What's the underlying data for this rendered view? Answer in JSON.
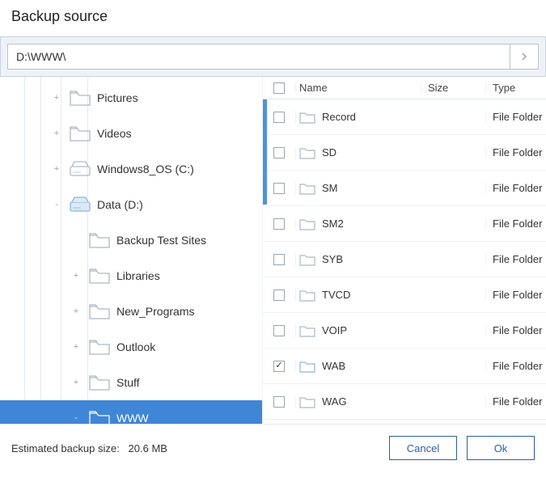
{
  "dialog_title": "Backup source",
  "path_value": "D:\\WWW\\",
  "tree": {
    "items": [
      {
        "indent": 3,
        "expander": "+",
        "icon": "folder",
        "label": "Pictures"
      },
      {
        "indent": 3,
        "expander": "+",
        "icon": "folder",
        "label": "Videos"
      },
      {
        "indent": 3,
        "expander": "+",
        "icon": "drive",
        "label": "Windows8_OS (C:)"
      },
      {
        "indent": 3,
        "expander": "-",
        "icon": "drive-blue",
        "label": "Data (D:)"
      },
      {
        "indent": 4,
        "expander": "",
        "icon": "folder",
        "label": "Backup Test Sites"
      },
      {
        "indent": 4,
        "expander": "+",
        "icon": "folder",
        "label": "Libraries"
      },
      {
        "indent": 4,
        "expander": "+",
        "icon": "folder",
        "label": "New_Programs"
      },
      {
        "indent": 4,
        "expander": "+",
        "icon": "folder",
        "label": "Outlook"
      },
      {
        "indent": 4,
        "expander": "+",
        "icon": "folder",
        "label": "Stuff"
      },
      {
        "indent": 4,
        "expander": "-",
        "icon": "folder-sel",
        "label": "WWW",
        "selected": true
      }
    ]
  },
  "list": {
    "headers": {
      "name": "Name",
      "size": "Size",
      "type": "Type"
    },
    "rows": [
      {
        "checked": false,
        "name": "Record",
        "size": "",
        "type": "File Folder"
      },
      {
        "checked": false,
        "name": "SD",
        "size": "",
        "type": "File Folder"
      },
      {
        "checked": false,
        "name": "SM",
        "size": "",
        "type": "File Folder"
      },
      {
        "checked": false,
        "name": "SM2",
        "size": "",
        "type": "File Folder"
      },
      {
        "checked": false,
        "name": "SYB",
        "size": "",
        "type": "File Folder"
      },
      {
        "checked": false,
        "name": "TVCD",
        "size": "",
        "type": "File Folder"
      },
      {
        "checked": false,
        "name": "VOIP",
        "size": "",
        "type": "File Folder"
      },
      {
        "checked": true,
        "name": "WAB",
        "size": "",
        "type": "File Folder"
      },
      {
        "checked": false,
        "name": "WAG",
        "size": "",
        "type": "File Folder"
      }
    ]
  },
  "footer": {
    "est_label": "Estimated backup size:",
    "est_value": "20.6 MB",
    "cancel": "Cancel",
    "ok": "Ok"
  },
  "icons": {
    "folder_stroke": "#aeb8c4",
    "folder_sel_stroke": "#ffffff",
    "drive_stroke": "#aeb8c4",
    "drive_blue": "#8fb3dc"
  }
}
